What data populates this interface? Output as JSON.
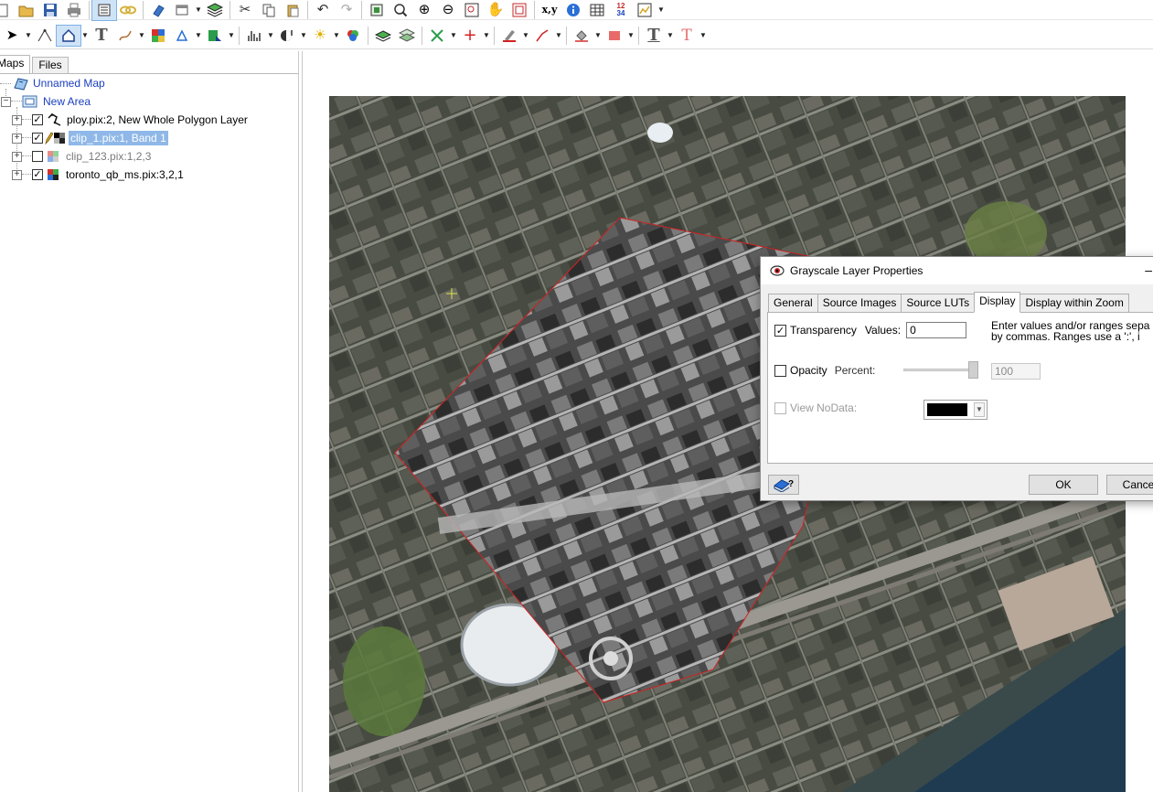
{
  "panel": {
    "tabs": [
      "Maps",
      "Files"
    ],
    "tree": [
      {
        "label": "Unnamed Map",
        "style": "blue"
      },
      {
        "label": "New Area",
        "style": "blue"
      },
      {
        "label": "ploy.pix:2, New Whole Polygon Layer",
        "checked": true
      },
      {
        "label": "clip_1.pix:1, Band 1",
        "checked": true,
        "selected": true
      },
      {
        "label": "clip_123.pix:1,2,3",
        "checked": false
      },
      {
        "label": "toronto_qb_ms.pix:3,2,1",
        "checked": true
      }
    ]
  },
  "toolbar1": {
    "xy_label": "x,y",
    "digits_label_top": "12",
    "digits_label_bottom": "34"
  },
  "dialog": {
    "title": "Grayscale Layer Properties",
    "tabs": [
      "General",
      "Source Images",
      "Source LUTs",
      "Display",
      "Display within Zoom"
    ],
    "transparency": {
      "label": "Transparency",
      "values_label": "Values:",
      "value": "0",
      "checked": true
    },
    "help_line1": "Enter values and/or ranges sepa",
    "help_line2": "by commas. Ranges use a ':',  i",
    "opacity": {
      "label": "Opacity",
      "percent_label": "Percent:",
      "value": "100",
      "checked": false,
      "level": 1.0
    },
    "nodata": {
      "label": "View NoData:",
      "checked": false,
      "color": "#000000"
    },
    "ok_label": "OK",
    "cancel_label": "Cance"
  },
  "colors": {
    "selection": "#8fb8e8",
    "tree_blue": "#1a3fbf",
    "clip_outline": "#d42020"
  }
}
